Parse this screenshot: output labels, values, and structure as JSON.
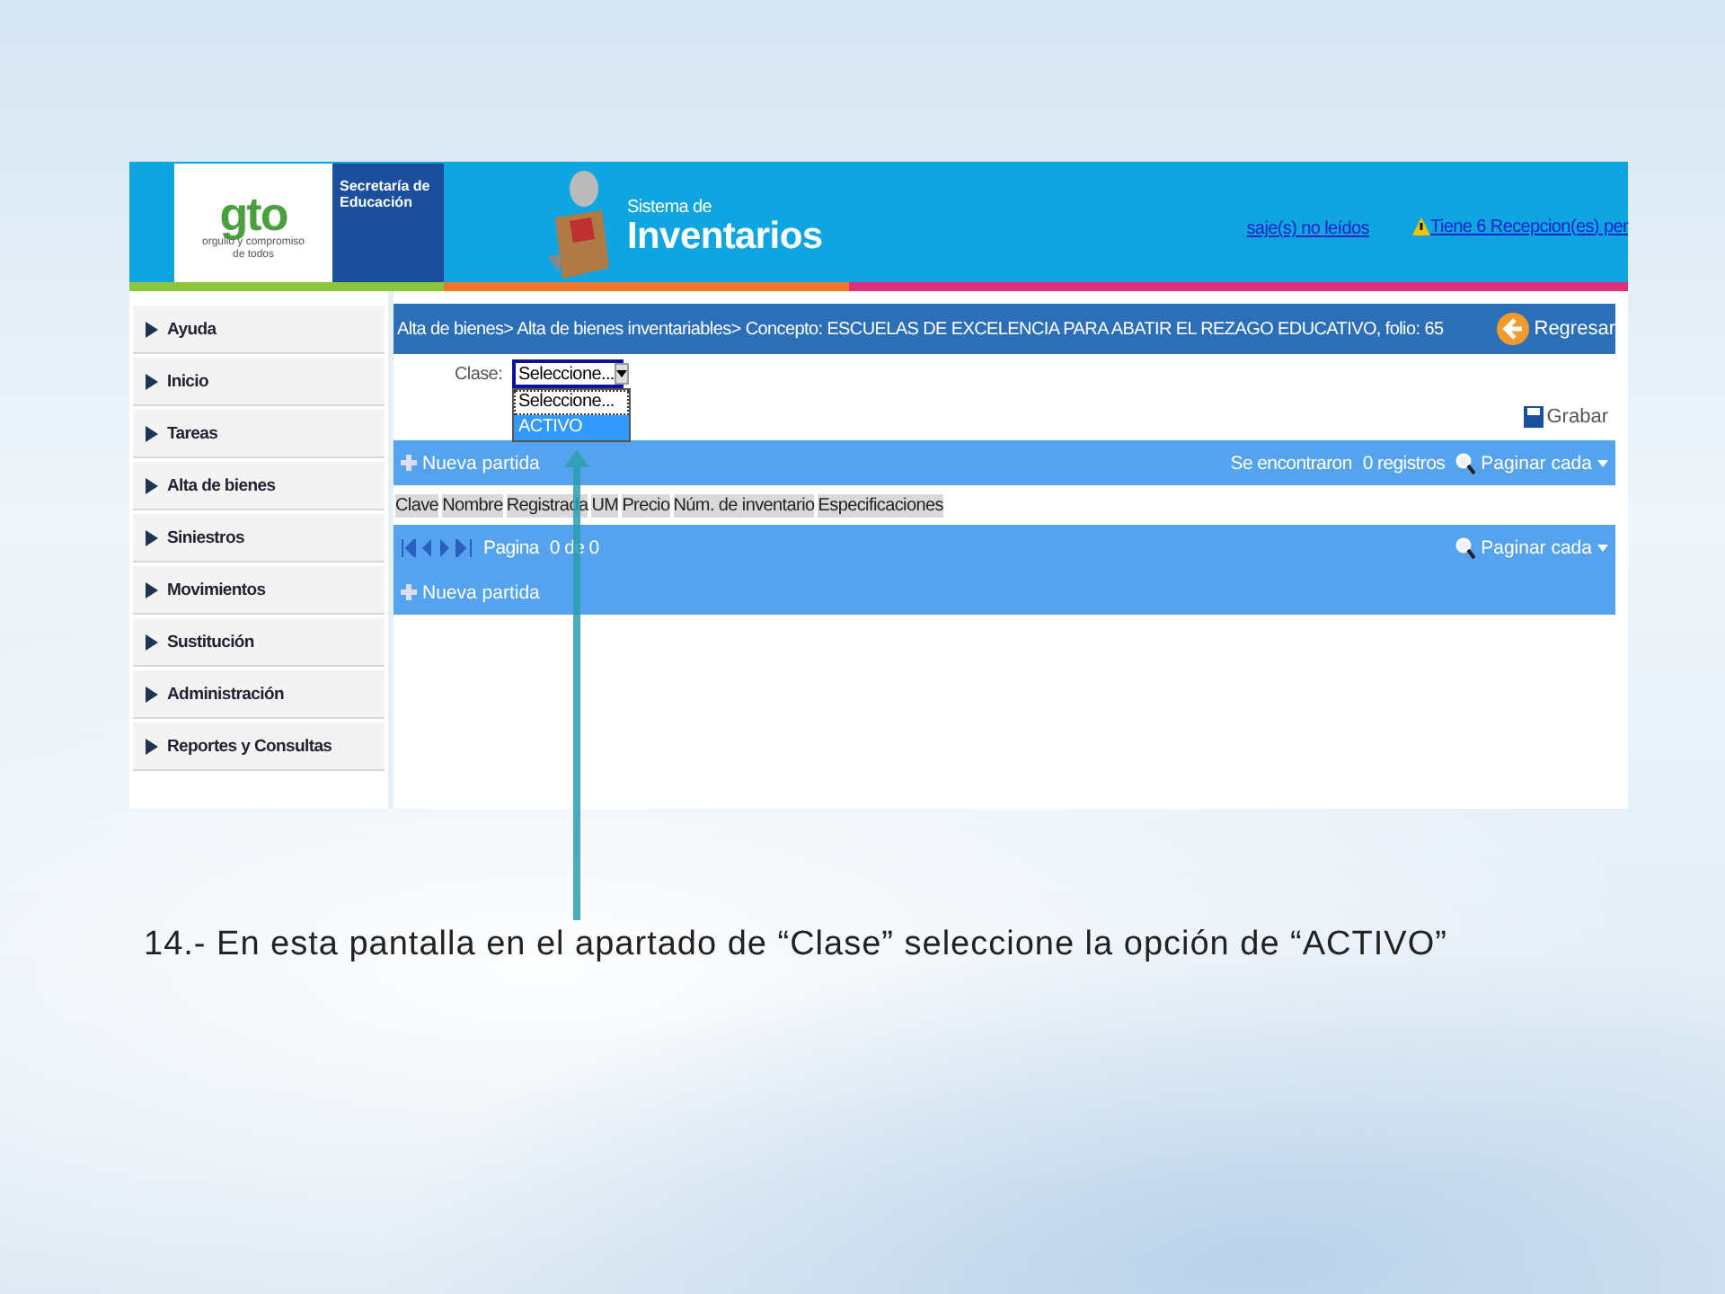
{
  "header": {
    "logo": {
      "mark": "gto",
      "tagline": "orgullo y compromiso de todos",
      "org": "Secretaría de Educación"
    },
    "system_small": "Sistema de",
    "system_title": "Inventarios",
    "messages_link": "saje(s) no leídos",
    "receptions_link": "Tiene 6 Recepcion(es) per"
  },
  "sidebar": {
    "items": [
      "Ayuda",
      "Inicio",
      "Tareas",
      "Alta de bienes",
      "Siniestros",
      "Movimientos",
      "Sustitución",
      "Administración",
      "Reportes y Consultas"
    ]
  },
  "breadcrumb": "Alta de bienes> Alta de bienes inventariables> Concepto: ESCUELAS DE EXCELENCIA PARA ABATIR EL REZAGO EDUCATIVO, folio: 65",
  "back_button": "Regresar",
  "clase": {
    "label": "Clase:",
    "value": "Seleccione...",
    "expanded": true,
    "options": [
      {
        "label": "Seleccione...",
        "selected": true,
        "highlighted": false
      },
      {
        "label": "ACTIVO",
        "selected": false,
        "highlighted": true
      }
    ]
  },
  "save_button": "Grabar",
  "top_bar": {
    "new_item": "Nueva partida",
    "found": "Se encontraron",
    "count": "0 registros",
    "paginate": "Paginar cada"
  },
  "table": {
    "columns": [
      "Clave",
      "Nombre",
      "Registrada",
      "UM",
      "Precio",
      "Núm. de inventario",
      "Especificaciones"
    ]
  },
  "bottom_bar": {
    "page_label": "Pagina",
    "page_value": "0 de 0",
    "paginate": "Paginar cada",
    "new_item": "Nueva partida"
  },
  "caption": "14.- En esta pantalla en el apartado de “Clase” seleccione la opción de “ACTIVO”"
}
